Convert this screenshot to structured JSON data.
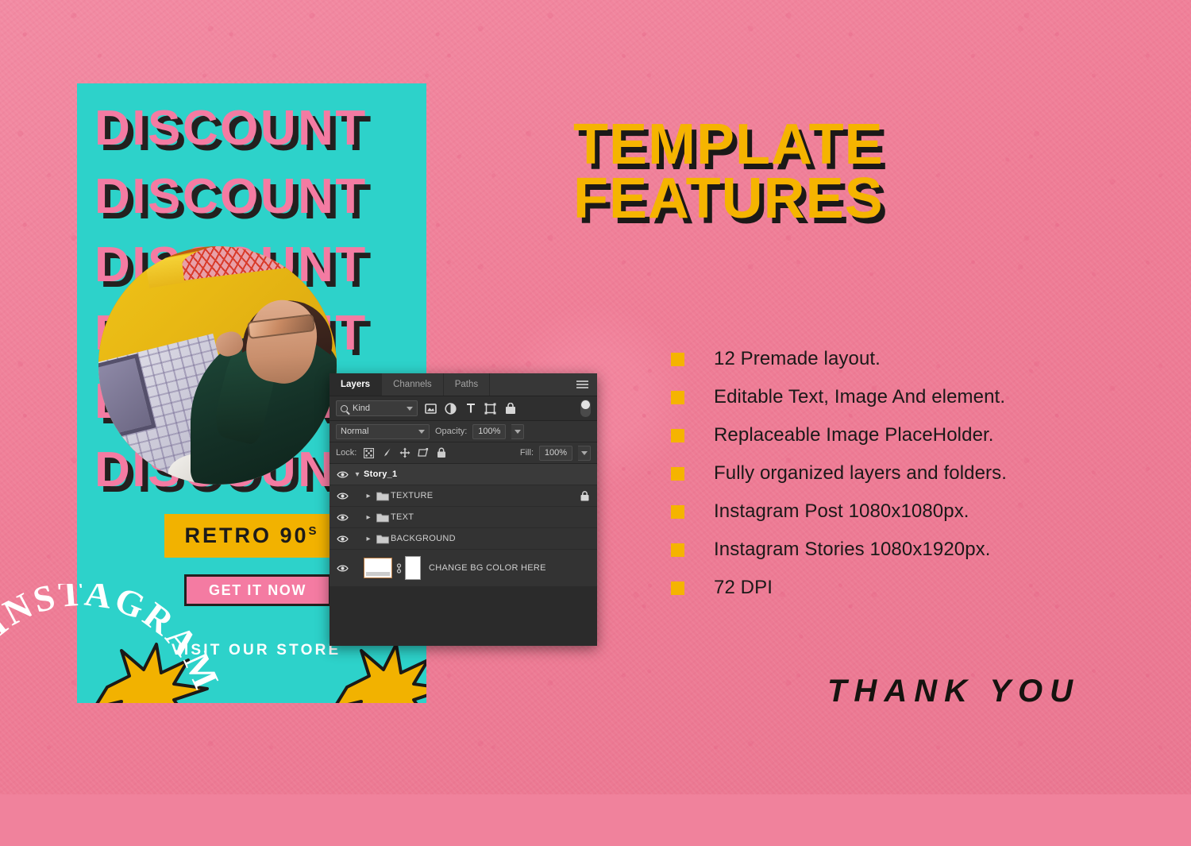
{
  "colors": {
    "background_pink": "#F08299",
    "poster_teal": "#2DD2CA",
    "accent_yellow": "#F5B400",
    "accent_pink": "#F47BA2",
    "dark": "#1B1918",
    "panel_bg": "#2B2B2B"
  },
  "poster": {
    "discount_lines": [
      "DISCOUNT",
      "DISCOUNT",
      "DISCOUNT",
      "DISCOUNT",
      "DISCOUNT",
      "DISCOUNT"
    ],
    "badge_text": "RETRO 90",
    "badge_sup": "S",
    "cta_label": "GET IT NOW",
    "store_label": "VISIT OUR STORE"
  },
  "instagram_arc": {
    "text": "INSTAGRAM"
  },
  "photoshop_panel": {
    "tabs": [
      {
        "label": "Layers",
        "active": true
      },
      {
        "label": "Channels",
        "active": false
      },
      {
        "label": "Paths",
        "active": false
      }
    ],
    "menu_icon": "hamburger-menu-icon",
    "filter_bar": {
      "kind_label": "Kind",
      "search_icon": "search-icon",
      "icons": [
        "image-filter-icon",
        "adjustment-filter-icon",
        "type-filter-icon",
        "shape-filter-icon",
        "smart-object-filter-icon"
      ],
      "toggle_icon": "filter-toggle-switch"
    },
    "blend_bar": {
      "blend_mode": "Normal",
      "opacity_label": "Opacity:",
      "opacity_value": "100%"
    },
    "lock_bar": {
      "lock_label": "Lock:",
      "icons": [
        "lock-transparent-pixels-icon",
        "lock-image-pixels-icon",
        "lock-position-icon",
        "lock-artboard-icon",
        "lock-all-icon"
      ],
      "fill_label": "Fill:",
      "fill_value": "100%"
    },
    "layers": [
      {
        "name": "Story_1",
        "type": "group-head",
        "visible": true,
        "expanded": true,
        "locked": false
      },
      {
        "name": "TEXTURE",
        "type": "folder",
        "visible": true,
        "expanded": false,
        "locked": true
      },
      {
        "name": "TEXT",
        "type": "folder",
        "visible": true,
        "expanded": false,
        "locked": false
      },
      {
        "name": "BACKGROUND",
        "type": "folder",
        "visible": true,
        "expanded": false,
        "locked": false
      },
      {
        "name": "CHANGE BG COLOR HERE",
        "type": "solid-color",
        "visible": true,
        "expanded": false,
        "locked": false
      }
    ]
  },
  "right_panel": {
    "heading_line1": "TEMPLATE",
    "heading_line2": "FEATURES",
    "features": [
      "12 Premade layout.",
      "Editable Text, Image And element.",
      "Replaceable Image PlaceHolder.",
      "Fully organized layers and folders.",
      "Instagram Post 1080x1080px.",
      "Instagram Stories 1080x1920px.",
      "72 DPI"
    ],
    "thank_you": "THANK YOU"
  }
}
